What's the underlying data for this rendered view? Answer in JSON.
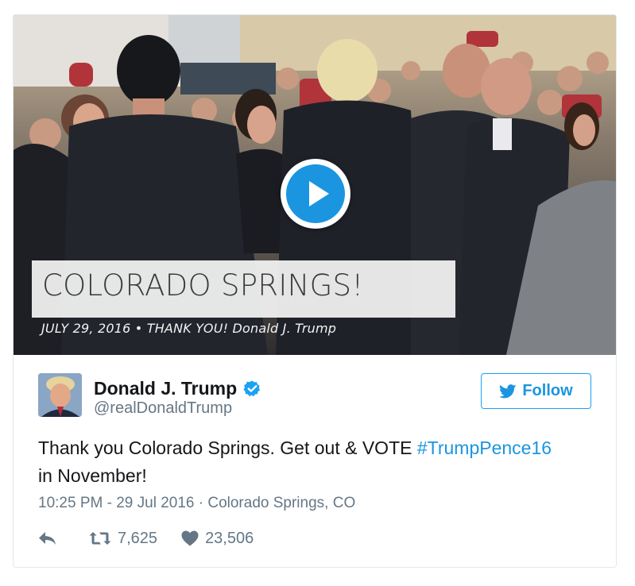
{
  "media": {
    "caption_title": "COLORADO SPRINGS!",
    "caption_subtitle": "JULY 29, 2016 • THANK YOU! Donald J. Trump",
    "play_icon": "play-icon"
  },
  "author": {
    "name": "Donald J. Trump",
    "handle": "@realDonaldTrump",
    "verified_icon": "verified-badge-icon"
  },
  "follow": {
    "label": "Follow",
    "icon": "twitter-bird-icon"
  },
  "tweet": {
    "text_before": "Thank you Colorado Springs. Get out & VOTE ",
    "hashtag": "#TrumpPence16",
    "text_after": " in November!"
  },
  "meta": {
    "timestamp": "10:25 PM - 29 Jul 2016",
    "separator": " · ",
    "location": "Colorado Springs, CO"
  },
  "actions": {
    "retweets": "7,625",
    "likes": "23,506"
  },
  "colors": {
    "accent": "#1b95e0",
    "text": "#14171a",
    "muted": "#657786",
    "border": "#e1e8ed"
  }
}
